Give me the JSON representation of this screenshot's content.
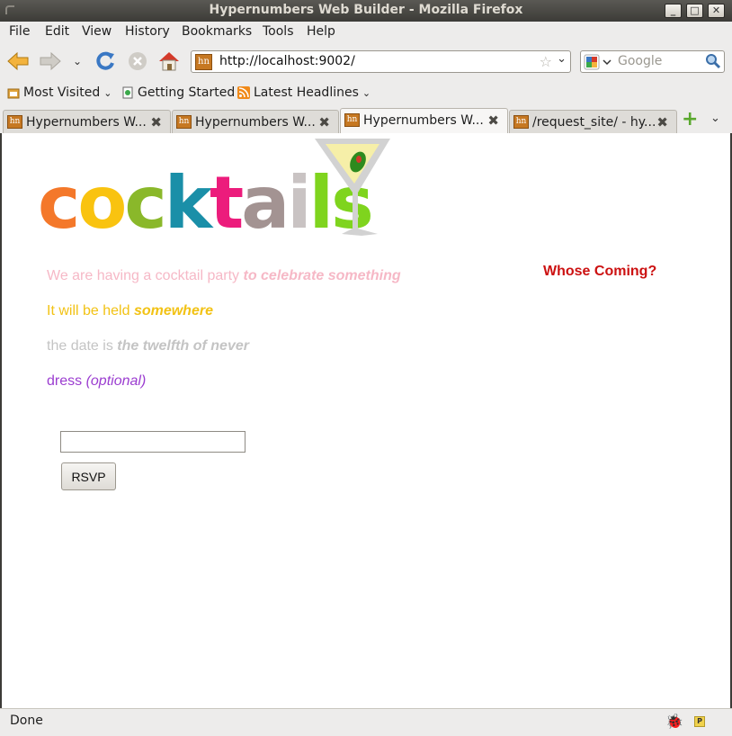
{
  "window": {
    "title": "Hypernumbers Web Builder - Mozilla Firefox",
    "buttons": {
      "minimize": "_",
      "maximize": "□",
      "close": "✕"
    }
  },
  "menubar": {
    "items": [
      "File",
      "Edit",
      "View",
      "History",
      "Bookmarks",
      "Tools",
      "Help"
    ],
    "mnemonics": [
      "F",
      "E",
      "V",
      "s",
      "B",
      "T",
      "H"
    ]
  },
  "navbar": {
    "url": "http://localhost:9002/",
    "search_placeholder": "Google"
  },
  "bookmarks": {
    "items": [
      "Most Visited",
      "Getting Started",
      "Latest Headlines"
    ]
  },
  "tabs": [
    {
      "label": "Hypernumbers W...",
      "active": false
    },
    {
      "label": "Hypernumbers W...",
      "active": false
    },
    {
      "label": "Hypernumbers W...",
      "active": true
    },
    {
      "label": "/request_site/ - hy...",
      "active": false
    }
  ],
  "tab_favicon_text": "hn",
  "page": {
    "logo_letters": [
      {
        "ch": "c",
        "color": "#f4782a"
      },
      {
        "ch": "o",
        "color": "#f9c310"
      },
      {
        "ch": "c",
        "color": "#8ab82a"
      },
      {
        "ch": "k",
        "color": "#1a8fa8"
      },
      {
        "ch": "t",
        "color": "#ec1c7c"
      },
      {
        "ch": "a",
        "color": "#a39392"
      },
      {
        "ch": "i",
        "color": "#c9c3c3"
      },
      {
        "ch": "l",
        "color": "#7fd41e"
      },
      {
        "ch": "s",
        "color": "#7fd41e"
      }
    ],
    "line1": {
      "text": "We are having a cocktail party ",
      "em": "to celebrate something",
      "color": "#f6b8c6"
    },
    "line2": {
      "text": "It will be held ",
      "em": "somewhere",
      "color": "#f2c214"
    },
    "line3": {
      "text": "the date is ",
      "em": "the twelfth of never",
      "color": "#c4c4c4"
    },
    "line4": {
      "text": "dress ",
      "em": "(optional)",
      "color": "#9b3dd0"
    },
    "whose_coming": "Whose Coming?",
    "rsvp_value": "",
    "rsvp_button": "RSVP"
  },
  "status": {
    "text": "Done"
  }
}
